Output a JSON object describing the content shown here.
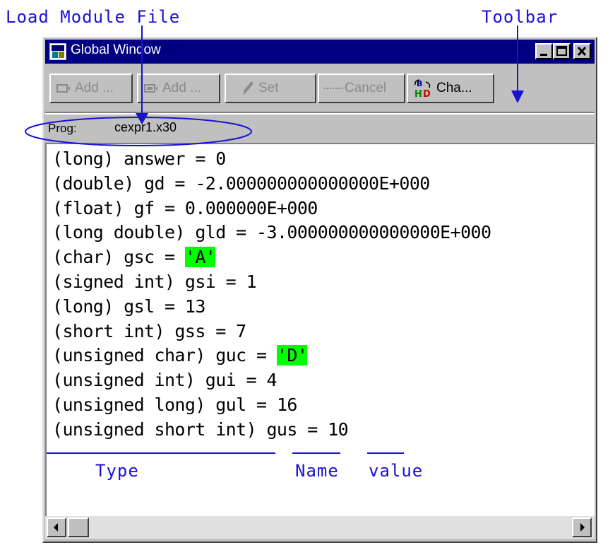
{
  "annotations": {
    "load_module_file": "Load Module File",
    "toolbar": "Toolbar",
    "type": "Type",
    "name": "Name",
    "value": "value"
  },
  "window": {
    "title": "Global Window",
    "title_icon": "app-window-icon",
    "controls": {
      "minimize": "minimize-icon",
      "maximize": "maximize-icon",
      "close": "close-icon"
    }
  },
  "toolbar": {
    "buttons": [
      {
        "label": "Add ...",
        "icon": "add-watch-icon",
        "enabled": false
      },
      {
        "label": "Add ...",
        "icon": "add-watch-all-icon",
        "enabled": false
      },
      {
        "label": "Set",
        "icon": "pencil-icon",
        "enabled": false
      },
      {
        "label": "Cancel",
        "icon": "cancel-icon",
        "enabled": false
      },
      {
        "label": "Cha...",
        "icon": "radix-change-icon",
        "enabled": true
      }
    ]
  },
  "program": {
    "label": "Prog:",
    "file": "cexpr1.x30"
  },
  "variables": [
    {
      "type": "(long)",
      "name": "answer",
      "value": "0"
    },
    {
      "type": "(double)",
      "name": "gd",
      "value": "-2.000000000000000E+000"
    },
    {
      "type": "(float)",
      "name": "gf",
      "value": "0.000000E+000"
    },
    {
      "type": "(long double)",
      "name": "gld",
      "value": "-3.000000000000000E+000"
    },
    {
      "type": "(char)",
      "name": "gsc",
      "value": "'A'",
      "highlight": true
    },
    {
      "type": "(signed int)",
      "name": "gsi",
      "value": "1"
    },
    {
      "type": "(long)",
      "name": "gsl",
      "value": "13"
    },
    {
      "type": "(short int)",
      "name": "gss",
      "value": "7"
    },
    {
      "type": "(unsigned char)",
      "name": "guc",
      "value": "'D'",
      "highlight": true
    },
    {
      "type": "(unsigned int)",
      "name": "gui",
      "value": "4"
    },
    {
      "type": "(unsigned long)",
      "name": "gul",
      "value": "16"
    },
    {
      "type": "(unsigned short int)",
      "name": "gus",
      "value": "10"
    }
  ],
  "colors": {
    "annotation": "#1a10d8",
    "highlight": "#00ff00",
    "titlebar": "#000080"
  }
}
